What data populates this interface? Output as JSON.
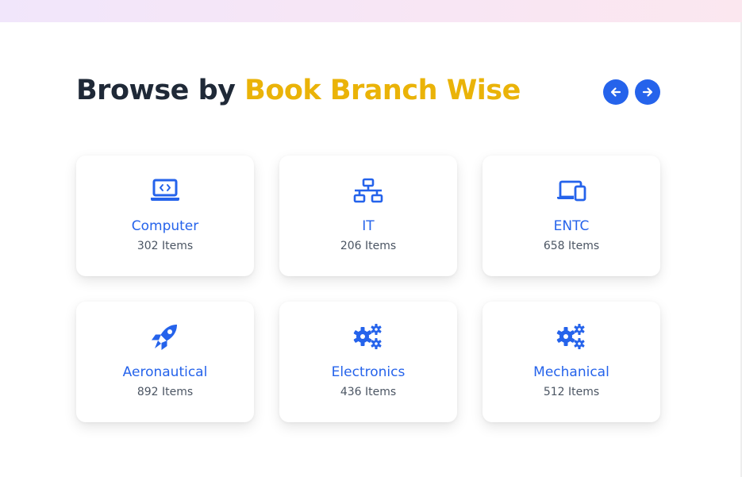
{
  "header": {
    "title_prefix": "Browse by ",
    "title_accent": "Book Branch Wise"
  },
  "nav": {
    "prev_icon": "arrow-left-icon",
    "next_icon": "arrow-right-icon"
  },
  "colors": {
    "primary": "#2563eb",
    "accent": "#eab308",
    "heading": "#1f2937",
    "muted": "#4b5563"
  },
  "branches": [
    {
      "name": "Computer",
      "count": "302 Items",
      "icon": "laptop-code-icon"
    },
    {
      "name": "IT",
      "count": "206 Items",
      "icon": "network-icon"
    },
    {
      "name": "ENTC",
      "count": "658 Items",
      "icon": "devices-icon"
    },
    {
      "name": "Aeronautical",
      "count": "892 Items",
      "icon": "rocket-icon"
    },
    {
      "name": "Electronics",
      "count": "436 Items",
      "icon": "gears-icon"
    },
    {
      "name": "Mechanical",
      "count": "512 Items",
      "icon": "gears-icon"
    }
  ]
}
